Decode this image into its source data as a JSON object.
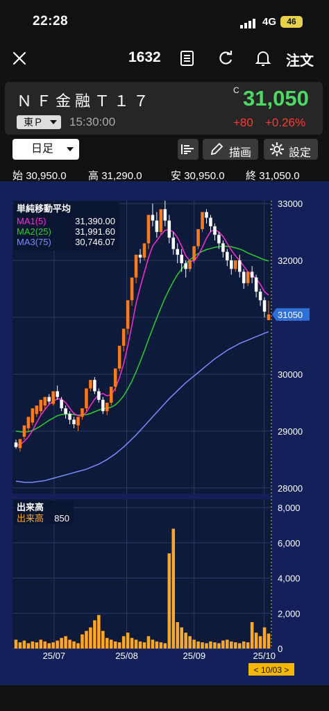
{
  "status_bar": {
    "time": "22:28",
    "network": "4G",
    "battery": "46"
  },
  "nav": {
    "title": "1632",
    "order_label": "注文"
  },
  "quote": {
    "name": "ＮＦ金融Ｔ１７",
    "price_flag": "C",
    "price": "31,050",
    "market": "東Ｐ",
    "time": "15:30:00",
    "change": "+80",
    "change_pct": "+0.26%"
  },
  "toolbar": {
    "period": "日足",
    "draw_label": "描画",
    "settings_label": "設定"
  },
  "ohlc": {
    "open_label": "始",
    "open": "30,950.0",
    "high_label": "高",
    "high": "31,290.0",
    "low_label": "安",
    "low": "30,950.0",
    "close_label": "終",
    "close": "31,050.0"
  },
  "colors": {
    "up": "#ff7a1a",
    "down": "#ffffff",
    "ma1": "#ff2bd6",
    "ma2": "#2ad02a",
    "ma3": "#7b8cff",
    "volume": "#ffa726",
    "price_tag": "#2f6fd6",
    "chart_bg": "#13205a"
  },
  "chart_data": [
    {
      "type": "candlestick",
      "legend_title": "単純移動平均",
      "series": [
        {
          "name": "MA1(5)",
          "last": "31,390.00",
          "color": "#ff2bd6"
        },
        {
          "name": "MA2(25)",
          "last": "31,991.60",
          "color": "#2ad02a"
        },
        {
          "name": "MA3(75)",
          "last": "30,746.07",
          "color": "#7b8cff"
        }
      ],
      "y_ticks": [
        "33000",
        "32000",
        "31000",
        "30000",
        "29000",
        "28000"
      ],
      "ylim": [
        27900,
        33050
      ],
      "last_price_tag": "31050",
      "x_ticks": [
        "25/07",
        "25/08",
        "25/09",
        "25/10"
      ],
      "grid": true,
      "candles": [
        [
          28800,
          28850,
          28720,
          28690
        ],
        [
          28700,
          28760,
          28860,
          28640
        ],
        [
          28900,
          28950,
          29100,
          28850
        ],
        [
          29050,
          29100,
          29250,
          28990
        ],
        [
          29150,
          29200,
          29400,
          29100
        ],
        [
          29300,
          29350,
          29450,
          29250
        ],
        [
          29350,
          29420,
          29550,
          29300
        ],
        [
          29450,
          29480,
          29600,
          29380
        ],
        [
          29600,
          29650,
          29520,
          29480
        ],
        [
          29480,
          29520,
          29700,
          29450
        ],
        [
          29700,
          29800,
          29600,
          29550
        ],
        [
          29550,
          29600,
          29400,
          29350
        ],
        [
          29400,
          29450,
          29300,
          29220
        ],
        [
          29300,
          29350,
          29200,
          29120
        ],
        [
          29200,
          29250,
          29120,
          29050
        ],
        [
          29100,
          29150,
          29250,
          29000
        ],
        [
          29250,
          29300,
          29400,
          29200
        ],
        [
          29400,
          29500,
          29750,
          29350
        ],
        [
          29750,
          29800,
          29900,
          29700
        ],
        [
          29900,
          29950,
          29700,
          29650
        ],
        [
          29700,
          29750,
          29550,
          29500
        ],
        [
          29550,
          29600,
          29350,
          29300
        ],
        [
          29350,
          29420,
          29500,
          29280
        ],
        [
          29500,
          29550,
          29780,
          29450
        ],
        [
          29780,
          29850,
          30100,
          29700
        ],
        [
          30100,
          30300,
          30500,
          30050
        ],
        [
          30500,
          30700,
          30800,
          30400
        ],
        [
          30800,
          31000,
          31300,
          30700
        ],
        [
          31300,
          31600,
          31700,
          31200
        ],
        [
          31700,
          31900,
          32100,
          31600
        ],
        [
          32100,
          32200,
          32050,
          31950
        ],
        [
          32050,
          32150,
          32300,
          32000
        ],
        [
          32300,
          32600,
          32800,
          32200
        ],
        [
          32800,
          33000,
          32700,
          32600
        ],
        [
          32700,
          32850,
          32500,
          32400
        ],
        [
          32500,
          32650,
          32900,
          32450
        ],
        [
          32900,
          33050,
          32700,
          32600
        ],
        [
          32700,
          32800,
          32400,
          32300
        ],
        [
          32400,
          32500,
          32200,
          32100
        ],
        [
          32200,
          32300,
          32100,
          31950
        ],
        [
          32100,
          32200,
          31950,
          31800
        ],
        [
          31950,
          32000,
          31850,
          31700
        ],
        [
          31850,
          31950,
          32000,
          31800
        ],
        [
          32000,
          32100,
          32250,
          31950
        ],
        [
          32250,
          32400,
          32550,
          32200
        ],
        [
          32550,
          32700,
          32850,
          32500
        ],
        [
          32850,
          32900,
          32750,
          32650
        ],
        [
          32750,
          32800,
          32600,
          32500
        ],
        [
          32600,
          32650,
          32450,
          32350
        ],
        [
          32450,
          32500,
          32300,
          32200
        ],
        [
          32300,
          32350,
          32150,
          32050
        ],
        [
          32150,
          32200,
          32000,
          31900
        ],
        [
          32000,
          32100,
          31850,
          31750
        ],
        [
          31850,
          31950,
          32000,
          31800
        ],
        [
          32000,
          32100,
          31800,
          31700
        ],
        [
          31800,
          31850,
          31600,
          31500
        ],
        [
          31600,
          31700,
          31800,
          31550
        ],
        [
          31800,
          31900,
          31700,
          31600
        ],
        [
          31700,
          31750,
          31450,
          31350
        ],
        [
          31450,
          31500,
          31300,
          31200
        ],
        [
          31300,
          31350,
          31100,
          31000
        ],
        [
          30950,
          31290,
          31050,
          30950
        ]
      ],
      "ma1_values": [
        28750,
        28760,
        28820,
        28900,
        29010,
        29150,
        29280,
        29380,
        29470,
        29520,
        29570,
        29560,
        29500,
        29400,
        29310,
        29270,
        29270,
        29330,
        29450,
        29560,
        29640,
        29660,
        29620,
        29640,
        29750,
        29940,
        30180,
        30500,
        30860,
        31240,
        31530,
        31790,
        32050,
        32250,
        32350,
        32450,
        32530,
        32540,
        32500,
        32400,
        32250,
        32080,
        31990,
        31990,
        32090,
        32230,
        32390,
        32510,
        32540,
        32500,
        32420,
        32300,
        32180,
        32080,
        32000,
        31900,
        31800,
        31740,
        31680,
        31580,
        31450,
        31390
      ],
      "ma2_values": [
        29000,
        28990,
        28980,
        28990,
        29010,
        29050,
        29090,
        29140,
        29190,
        29230,
        29270,
        29290,
        29300,
        29300,
        29290,
        29280,
        29280,
        29290,
        29310,
        29340,
        29370,
        29390,
        29400,
        29420,
        29460,
        29530,
        29620,
        29740,
        29880,
        30040,
        30220,
        30410,
        30610,
        30800,
        30990,
        31170,
        31340,
        31490,
        31630,
        31750,
        31850,
        31940,
        32010,
        32070,
        32120,
        32160,
        32190,
        32210,
        32230,
        32240,
        32250,
        32250,
        32240,
        32220,
        32200,
        32170,
        32130,
        32100,
        32070,
        32040,
        32010,
        31990
      ],
      "ma3_values": [
        28120,
        28110,
        28100,
        28100,
        28100,
        28110,
        28120,
        28130,
        28150,
        28170,
        28190,
        28210,
        28230,
        28250,
        28270,
        28290,
        28310,
        28330,
        28360,
        28390,
        28420,
        28460,
        28500,
        28550,
        28600,
        28660,
        28720,
        28790,
        28860,
        28930,
        29010,
        29090,
        29170,
        29250,
        29330,
        29410,
        29490,
        29570,
        29640,
        29710,
        29780,
        29850,
        29910,
        29970,
        30030,
        30090,
        30150,
        30210,
        30270,
        30320,
        30370,
        30420,
        30460,
        30500,
        30540,
        30570,
        30600,
        30630,
        30660,
        30690,
        30720,
        30746
      ]
    },
    {
      "type": "bar",
      "title": "出来高",
      "legend": {
        "name": "出来高",
        "value": "850"
      },
      "y_ticks": [
        "8,000",
        "6,000",
        "4,000",
        "2,000",
        "0"
      ],
      "ylim": [
        0,
        8000
      ],
      "values": [
        500,
        350,
        450,
        300,
        400,
        350,
        500,
        400,
        300,
        350,
        450,
        600,
        700,
        500,
        400,
        300,
        800,
        1000,
        1200,
        1600,
        1900,
        1000,
        600,
        500,
        400,
        350,
        700,
        900,
        600,
        500,
        400,
        350,
        700,
        500,
        400,
        350,
        300,
        5400,
        6800,
        1500,
        1200,
        900,
        700,
        500,
        400,
        350,
        300,
        400,
        350,
        300,
        450,
        500,
        400,
        350,
        300,
        400,
        350,
        1500,
        900,
        700,
        1200,
        850
      ],
      "x_ticks": [
        "25/07",
        "25/08",
        "25/09",
        "25/10"
      ],
      "cursor_label": "< 10/03 >"
    }
  ]
}
